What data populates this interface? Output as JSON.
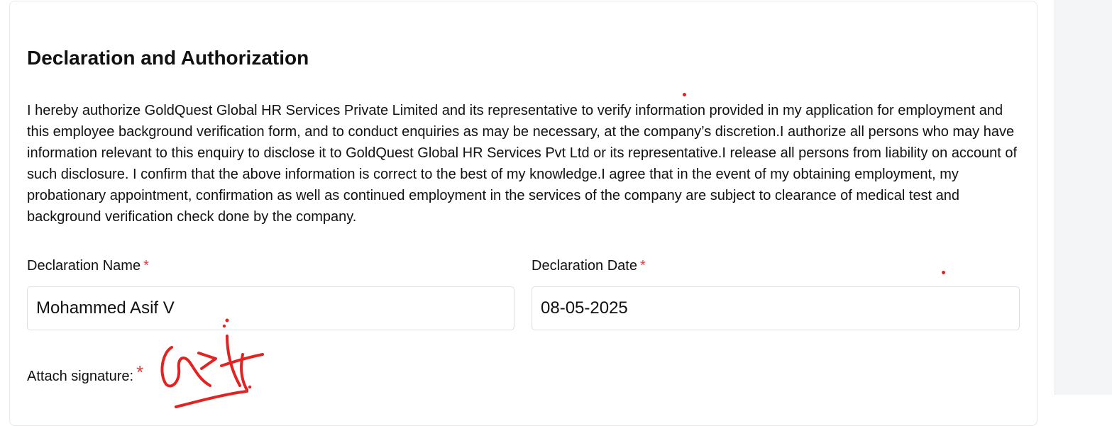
{
  "section": {
    "title": "Declaration and Authorization",
    "declaration_text": "I hereby authorize GoldQuest Global HR Services Private Limited and its representative to verify information provided in my application for employment and this employee background verification form, and to conduct enquiries as may be necessary, at the company’s discretion.I authorize all persons who may have information relevant to this enquiry to disclose it to GoldQuest Global HR Services Pvt Ltd or its representative.I release all persons from liability on account of such disclosure. I confirm that the above information is correct to the best of my knowledge.I agree that in the event of my obtaining employment, my probationary appointment, confirmation as well as continued employment in the services of the company are subject to clearance of medical test and background verification check done by the company."
  },
  "form": {
    "declaration_name": {
      "label": "Declaration Name",
      "required_mark": "*",
      "value": "Mohammed Asif V"
    },
    "declaration_date": {
      "label": "Declaration Date",
      "required_mark": "*",
      "value": "08-05-2025"
    },
    "signature": {
      "label": "Attach signature:",
      "required_mark": "*",
      "drawing": "handwritten-signature"
    }
  },
  "colors": {
    "required": "#e53935",
    "signature_ink": "#e32222",
    "card_border": "#e5e7eb",
    "input_border": "#dcdfe4",
    "gutter": "#f4f5f7"
  }
}
